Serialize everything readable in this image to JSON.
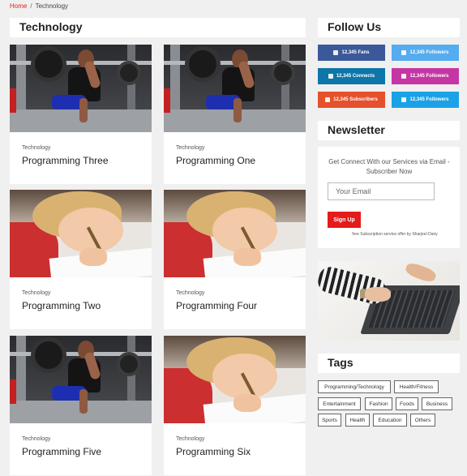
{
  "breadcrumb": {
    "home": "Home",
    "separator": "/",
    "current": "Technology"
  },
  "main": {
    "title": "Technology",
    "cards": [
      {
        "category": "Technology",
        "title": "Programming Three",
        "image": "gym-squat-photo"
      },
      {
        "category": "Technology",
        "title": "Programming One",
        "image": "gym-squat-photo"
      },
      {
        "category": "Technology",
        "title": "Programming Two",
        "image": "child-writing-photo"
      },
      {
        "category": "Technology",
        "title": "Programming Four",
        "image": "child-writing-photo"
      },
      {
        "category": "Technology",
        "title": "Programming Five",
        "image": "gym-squat-photo"
      },
      {
        "category": "Technology",
        "title": "Programming Six",
        "image": "child-writing-photo"
      }
    ]
  },
  "sidebar": {
    "follow": {
      "title": "Follow Us",
      "items": [
        {
          "label": "12,345 Fans",
          "icon": "facebook-icon",
          "color": "#3b5998"
        },
        {
          "label": "12,345 Followers",
          "icon": "twitter-icon",
          "color": "#55acee"
        },
        {
          "label": "12,345 Connects",
          "icon": "linkedin-icon",
          "color": "#0e76a8"
        },
        {
          "label": "12,345 Followers",
          "icon": "instagram-icon",
          "color": "#c536a4"
        },
        {
          "label": "12,345 Subscribers",
          "icon": "youtube-icon",
          "color": "#e4512c"
        },
        {
          "label": "12,345 Followers",
          "icon": "twitter-icon",
          "color": "#1ba2e6"
        }
      ]
    },
    "newsletter": {
      "title": "Newsletter",
      "description": "Get Connect With our Services via Email - Subscriber Now",
      "email_placeholder": "Your Email",
      "button_label": "Sign Up",
      "note": "free Subscription service offer by Sharjeel Dairy"
    },
    "tags": {
      "title": "Tags",
      "items": [
        "Programming/Technology",
        "Health/Fitness",
        "Entertainment",
        "Fashion",
        "Foods",
        "Business",
        "Sports",
        "Health",
        "Education",
        "Others"
      ]
    }
  },
  "colors": {
    "accent": "#e41b1b",
    "background": "#f0f0f0"
  }
}
